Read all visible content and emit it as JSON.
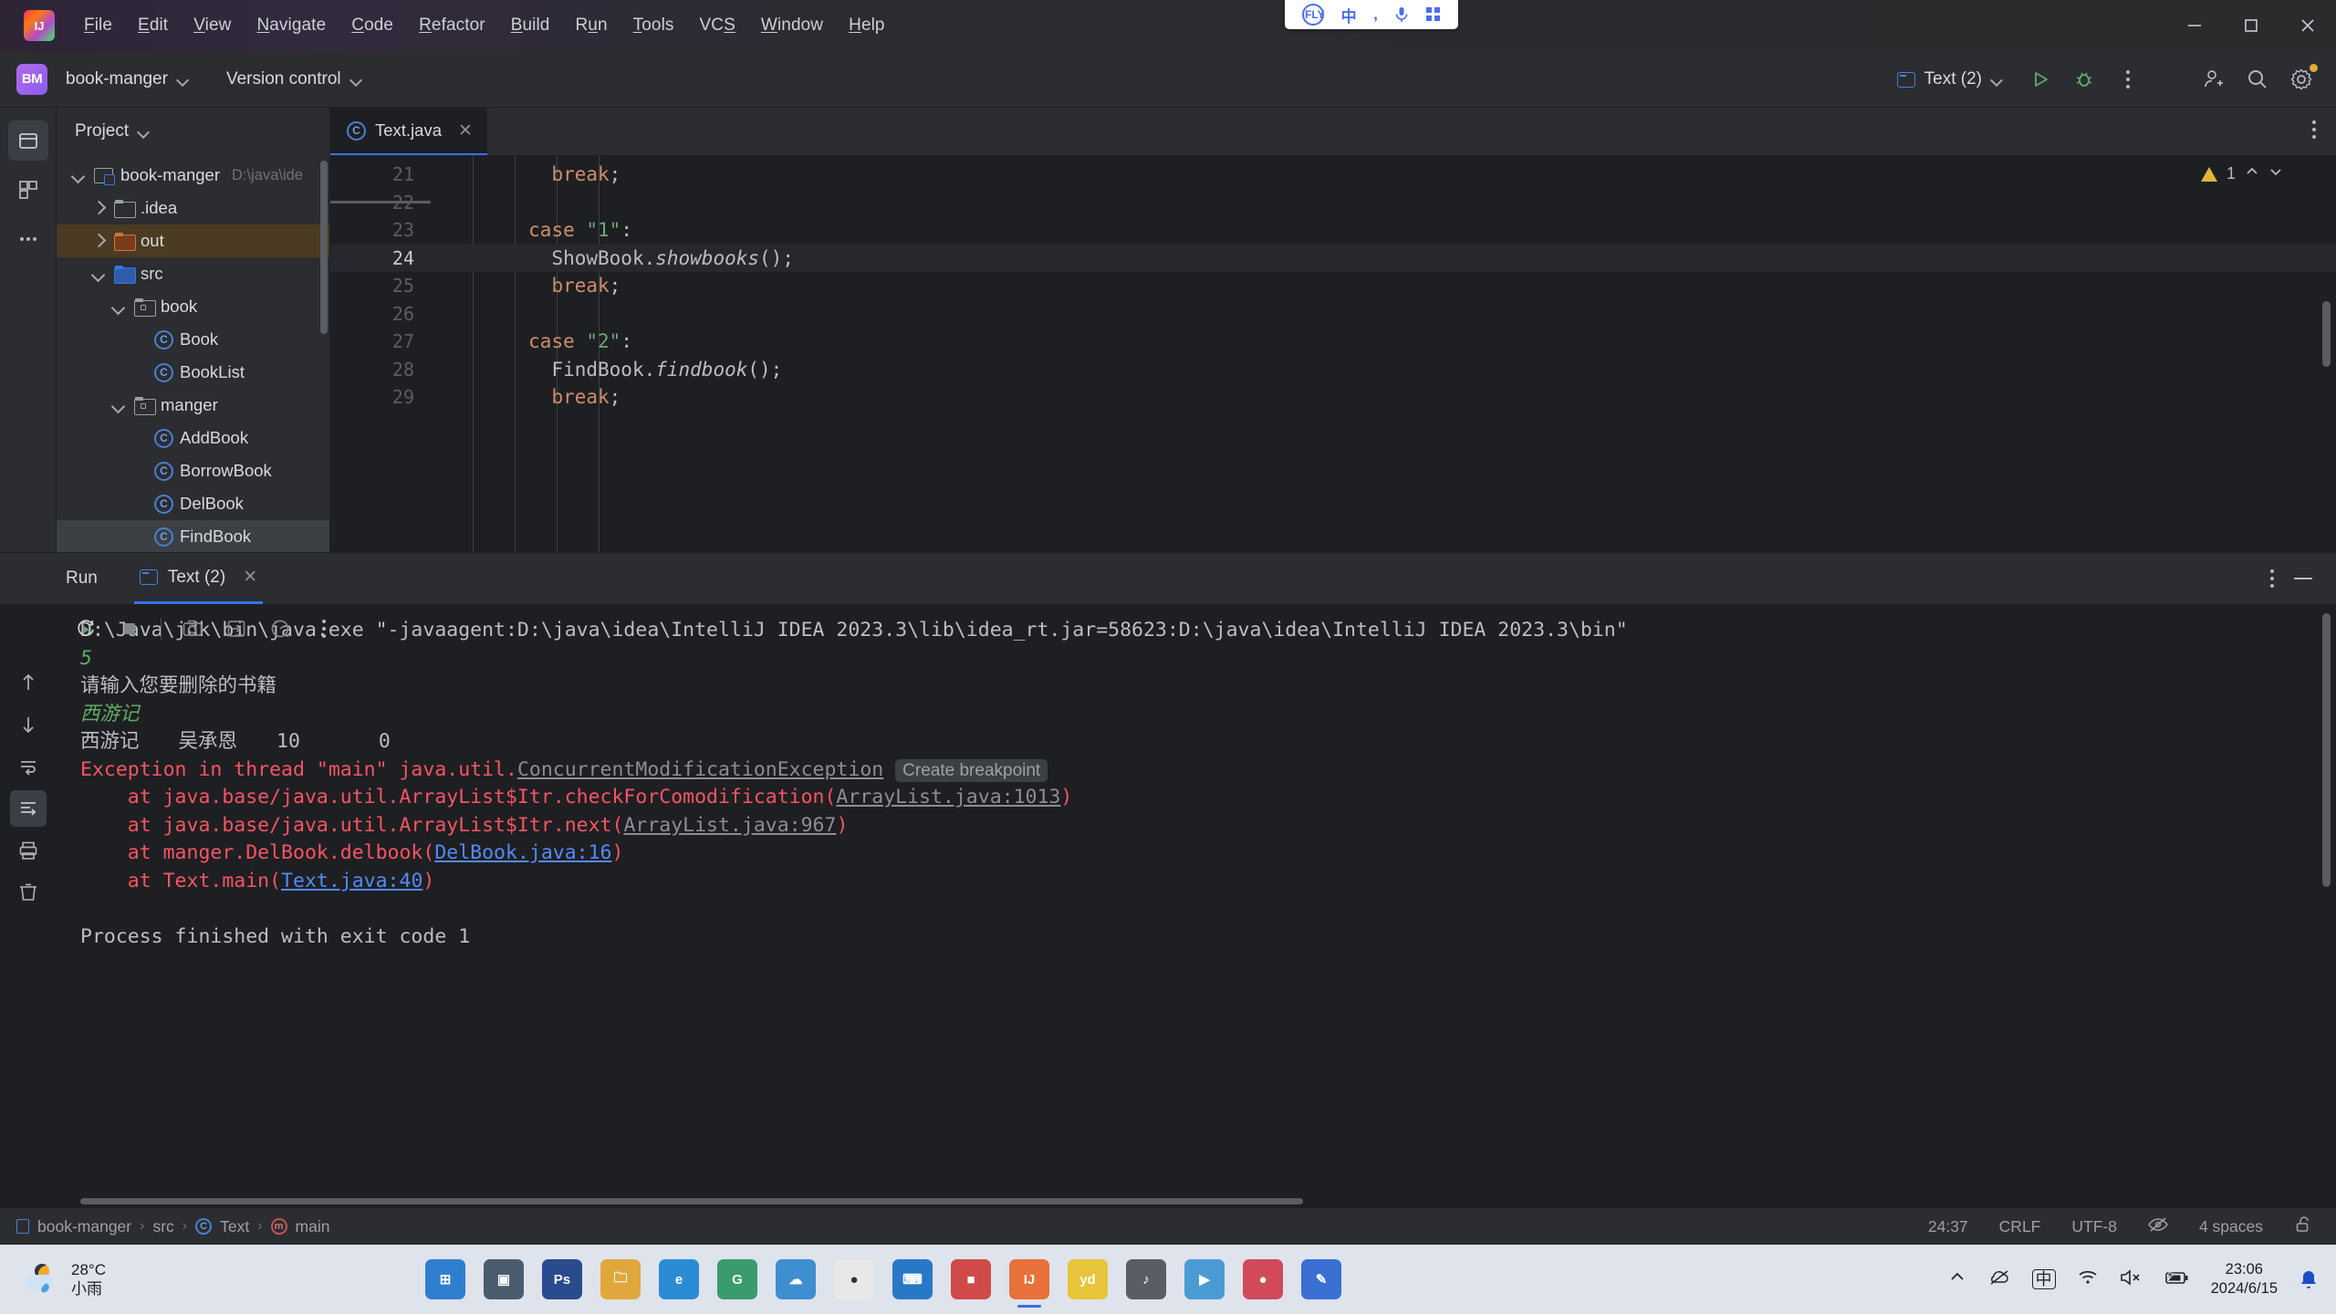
{
  "window": {
    "menus": [
      "File",
      "Edit",
      "View",
      "Navigate",
      "Code",
      "Refactor",
      "Build",
      "Run",
      "Tools",
      "VCS",
      "Window",
      "Help"
    ],
    "controls": [
      "minimize",
      "maximize",
      "close"
    ]
  },
  "ime": {
    "brand": "iFLY",
    "lang": "中",
    "comma": ",",
    "mic": "mic",
    "grid": "grid"
  },
  "projectbar": {
    "badge": "BM",
    "project_name": "book-manger",
    "vcs_label": "Version control",
    "run_config": "Text (2)",
    "buttons": [
      "run-button",
      "debug-button",
      "more-actions-button",
      "add-user-button",
      "search-button",
      "settings-button"
    ]
  },
  "sidebar": {
    "title": "Project",
    "tree": [
      {
        "label": "book-manger",
        "hint": "D:\\java\\ide",
        "indent": 0,
        "arrow": "down",
        "icon": "module",
        "state": "normal"
      },
      {
        "label": ".idea",
        "hint": "",
        "indent": 1,
        "arrow": "right",
        "icon": "folder",
        "state": "normal"
      },
      {
        "label": "out",
        "hint": "",
        "indent": 1,
        "arrow": "right",
        "icon": "folder-out",
        "state": "excluded"
      },
      {
        "label": "src",
        "hint": "",
        "indent": 1,
        "arrow": "down",
        "icon": "folder-src",
        "state": "normal"
      },
      {
        "label": "book",
        "hint": "",
        "indent": 2,
        "arrow": "down",
        "icon": "package",
        "state": "normal"
      },
      {
        "label": "Book",
        "hint": "",
        "indent": 3,
        "arrow": "none",
        "icon": "class",
        "state": "normal"
      },
      {
        "label": "BookList",
        "hint": "",
        "indent": 3,
        "arrow": "none",
        "icon": "class",
        "state": "normal"
      },
      {
        "label": "manger",
        "hint": "",
        "indent": 2,
        "arrow": "down",
        "icon": "package",
        "state": "normal"
      },
      {
        "label": "AddBook",
        "hint": "",
        "indent": 3,
        "arrow": "none",
        "icon": "class",
        "state": "normal"
      },
      {
        "label": "BorrowBook",
        "hint": "",
        "indent": 3,
        "arrow": "none",
        "icon": "class",
        "state": "normal"
      },
      {
        "label": "DelBook",
        "hint": "",
        "indent": 3,
        "arrow": "none",
        "icon": "class",
        "state": "normal"
      },
      {
        "label": "FindBook",
        "hint": "",
        "indent": 3,
        "arrow": "none",
        "icon": "class",
        "state": "selected"
      }
    ]
  },
  "editor": {
    "tab_label": "Text.java",
    "warning_count": "1",
    "lines": [
      {
        "num": "21",
        "indent": 10,
        "tokens": [
          {
            "t": "break",
            "c": "kw"
          },
          {
            "t": ";",
            "c": "plain"
          }
        ],
        "caret": false
      },
      {
        "num": "22",
        "indent": 0,
        "tokens": [],
        "caret": false
      },
      {
        "num": "23",
        "indent": 8,
        "tokens": [
          {
            "t": "case ",
            "c": "kw"
          },
          {
            "t": "\"1\"",
            "c": "str"
          },
          {
            "t": ":",
            "c": "plain"
          }
        ],
        "caret": false
      },
      {
        "num": "24",
        "indent": 10,
        "tokens": [
          {
            "t": "ShowBook.",
            "c": "plain"
          },
          {
            "t": "showbooks",
            "c": "mth-static"
          },
          {
            "t": "();",
            "c": "plain"
          }
        ],
        "caret": true
      },
      {
        "num": "25",
        "indent": 10,
        "tokens": [
          {
            "t": "break",
            "c": "kw"
          },
          {
            "t": ";",
            "c": "plain"
          }
        ],
        "caret": false
      },
      {
        "num": "26",
        "indent": 0,
        "tokens": [],
        "caret": false
      },
      {
        "num": "27",
        "indent": 8,
        "tokens": [
          {
            "t": "case ",
            "c": "kw"
          },
          {
            "t": "\"2\"",
            "c": "str"
          },
          {
            "t": ":",
            "c": "plain"
          }
        ],
        "caret": false
      },
      {
        "num": "28",
        "indent": 10,
        "tokens": [
          {
            "t": "FindBook.",
            "c": "plain"
          },
          {
            "t": "findbook",
            "c": "mth-static"
          },
          {
            "t": "();",
            "c": "plain"
          }
        ],
        "caret": false
      },
      {
        "num": "29",
        "indent": 10,
        "tokens": [
          {
            "t": "break",
            "c": "kw"
          },
          {
            "t": ";",
            "c": "plain"
          }
        ],
        "caret": false
      }
    ]
  },
  "runpanel": {
    "title": "Run",
    "tab_label": "Text (2)",
    "toolbar": [
      "rerun-button",
      "stop-button",
      "screenshot-button",
      "step-into-button",
      "profiler-button",
      "more-button"
    ],
    "side_tools": [
      "scroll-up-button",
      "scroll-down-button",
      "soft-wrap-button",
      "scroll-to-end-button",
      "print-button",
      "clear-all-button"
    ],
    "console": [
      {
        "type": "plain",
        "text": "D:\\Java\\jdk\\bin\\java.exe \"-javaagent:D:\\java\\idea\\IntelliJ IDEA 2023.3\\lib\\idea_rt.jar=58623:D:\\java\\idea\\IntelliJ IDEA 2023.3\\bin\""
      },
      {
        "type": "input",
        "text": "5"
      },
      {
        "type": "plain",
        "text": "请输入您要删除的书籍"
      },
      {
        "type": "input",
        "text": "西游记"
      },
      {
        "type": "plain",
        "text": "西游记　　吴承恩　　10　　　　0"
      },
      {
        "type": "error-head",
        "prefix": "Exception in thread \"main\" java.util.",
        "link": "ConcurrentModificationException",
        "chip": "Create breakpoint"
      },
      {
        "type": "error-frame",
        "prefix": "    at java.base/java.util.ArrayList$Itr.checkForComodification(",
        "link": "ArrayList.java:1013",
        "link_style": "gray",
        "suffix": ")"
      },
      {
        "type": "error-frame",
        "prefix": "    at java.base/java.util.ArrayList$Itr.next(",
        "link": "ArrayList.java:967",
        "link_style": "gray",
        "suffix": ")"
      },
      {
        "type": "error-frame",
        "prefix": "    at manger.DelBook.delbook(",
        "link": "DelBook.java:16",
        "link_style": "blue",
        "suffix": ")"
      },
      {
        "type": "error-frame",
        "prefix": "    at Text.main(",
        "link": "Text.java:40",
        "link_style": "blue",
        "suffix": ")"
      },
      {
        "type": "blank",
        "text": ""
      },
      {
        "type": "plain",
        "text": "Process finished with exit code 1"
      }
    ]
  },
  "statusbar": {
    "breadcrumbs": [
      "book-manger",
      "src",
      "Text",
      "main"
    ],
    "caret_position": "24:37",
    "line_separator": "CRLF",
    "encoding": "UTF-8",
    "indent": "4 spaces",
    "icons": [
      "reader-mode-icon",
      "lock-open-icon"
    ]
  },
  "taskbar": {
    "weather_temp": "28°C",
    "weather_desc": "小雨",
    "apps": [
      {
        "name": "start-button",
        "color": "#2f7fd1",
        "glyph": "⊞"
      },
      {
        "name": "task-view-button",
        "color": "#4a5b6e",
        "glyph": "▣"
      },
      {
        "name": "app-ps",
        "color": "#2a4b8d",
        "glyph": "Ps"
      },
      {
        "name": "app-explorer",
        "color": "#e0a83c",
        "glyph": "🗀"
      },
      {
        "name": "app-edge",
        "color": "#2a8cd4",
        "glyph": "e"
      },
      {
        "name": "app-qq-music",
        "color": "#3a9b6e",
        "glyph": "G"
      },
      {
        "name": "app-cloud",
        "color": "#3f8ed0",
        "glyph": "☁"
      },
      {
        "name": "app-chrome",
        "color": "#e8e8e8",
        "glyph": "●"
      },
      {
        "name": "app-vscode",
        "color": "#2878c8",
        "glyph": "⌨"
      },
      {
        "name": "app-wechat",
        "color": "#d04a4a",
        "glyph": "■"
      },
      {
        "name": "app-intellij",
        "color": "#e8703a",
        "glyph": "IJ"
      },
      {
        "name": "app-youdao",
        "color": "#e8c43a",
        "glyph": "yd"
      },
      {
        "name": "app-music",
        "color": "#5a5d63",
        "glyph": "♪"
      },
      {
        "name": "app-video",
        "color": "#4a9bd4",
        "glyph": "▶"
      },
      {
        "name": "app-redbook",
        "color": "#d04a5a",
        "glyph": "●"
      },
      {
        "name": "app-editor",
        "color": "#3a6fd4",
        "glyph": "✎"
      }
    ],
    "tray": [
      "show-hidden-icons",
      "onedrive-offline-icon",
      "ime-chinese-icon",
      "wifi-icon",
      "volume-muted-icon",
      "battery-charging-icon"
    ],
    "time": "23:06",
    "date": "2024/6/15"
  }
}
